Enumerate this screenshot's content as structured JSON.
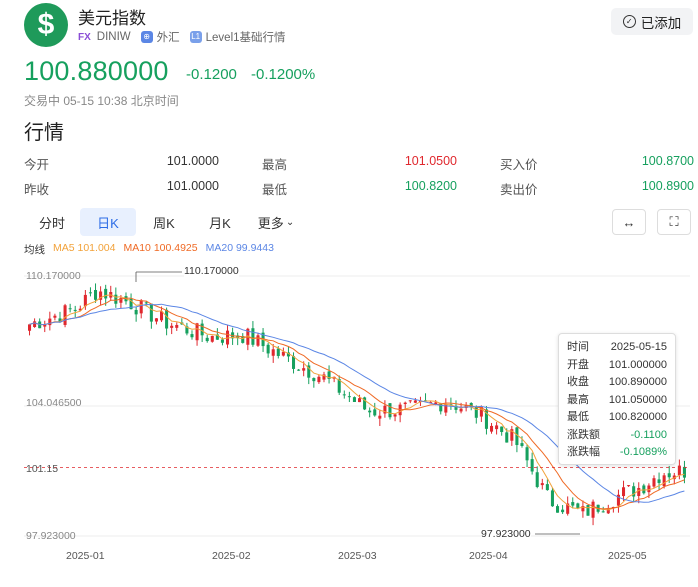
{
  "header": {
    "logo_symbol": "$",
    "title": "美元指数",
    "market_tag": "FX",
    "code": "DINIW",
    "category": "外汇",
    "level": "Level1基础行情",
    "add_button": "已添加"
  },
  "quote": {
    "price": "100.880000",
    "change": "-0.1200",
    "change_pct": "-0.1200%",
    "status": "交易中 05-15 10:38 北京时间"
  },
  "section_title": "行情",
  "stats": [
    {
      "label": "今开",
      "value": "101.0000",
      "color": "normal"
    },
    {
      "label": "最高",
      "value": "101.0500",
      "color": "red"
    },
    {
      "label": "买入价",
      "value": "100.8700",
      "color": "green"
    },
    {
      "label": "昨收",
      "value": "101.0000",
      "color": "normal"
    },
    {
      "label": "最低",
      "value": "100.8200",
      "color": "green"
    },
    {
      "label": "卖出价",
      "value": "100.8900",
      "color": "green"
    }
  ],
  "tabs": [
    {
      "label": "分时",
      "active": false
    },
    {
      "label": "日K",
      "active": true
    },
    {
      "label": "周K",
      "active": false
    },
    {
      "label": "月K",
      "active": false
    },
    {
      "label": "更多",
      "active": false
    }
  ],
  "toolbar": {
    "range_icon": "↔",
    "fullscreen_icon": "⛶"
  },
  "ma": {
    "label": "均线",
    "ma5": "MA5 101.004",
    "ma10": "MA10 100.4925",
    "ma20": "MA20 99.9443",
    "colors": {
      "ma5": "#f2a23a",
      "ma10": "#ef6a25",
      "ma20": "#5b86e5"
    }
  },
  "chart_data": {
    "type": "candlestick",
    "y_ticks": [
      "110.170000",
      "104.046500",
      "97.923000"
    ],
    "current_price_label": "101.15",
    "x_ticks": [
      "2025-01",
      "2025-02",
      "2025-03",
      "2025-04",
      "2025-05"
    ],
    "max_annotation": "110.170000",
    "min_annotation": "97.923000",
    "ylim": [
      97.923,
      110.17
    ],
    "colors": {
      "up": "#e0282e",
      "down": "#16a05e"
    }
  },
  "tooltip": {
    "rows": [
      {
        "k": "时间",
        "v": "2025-05-15"
      },
      {
        "k": "开盘",
        "v": "101.000000"
      },
      {
        "k": "收盘",
        "v": "100.890000"
      },
      {
        "k": "最高",
        "v": "101.050000"
      },
      {
        "k": "最低",
        "v": "100.820000"
      },
      {
        "k": "涨跌额",
        "v": "-0.1100"
      },
      {
        "k": "涨跌幅",
        "v": "-0.1089%"
      }
    ]
  }
}
